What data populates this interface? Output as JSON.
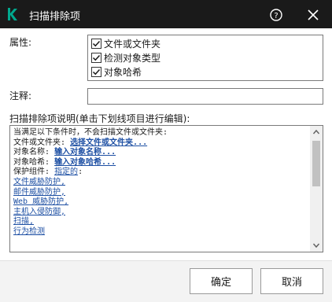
{
  "window": {
    "title": "扫描排除项",
    "logo_glyph": "K",
    "brand_color": "#00a88e",
    "titlebar_color": "#1a1a1a"
  },
  "form": {
    "attributes_label": "属性:",
    "attributes": [
      {
        "label": "文件或文件夹",
        "checked": true
      },
      {
        "label": "检测对象类型",
        "checked": true
      },
      {
        "label": "对象哈希",
        "checked": true
      }
    ],
    "comment_label": "注释:",
    "comment_value": "",
    "description_label": "扫描排除项说明(单击下划线项目进行编辑):"
  },
  "description": {
    "line1": "当满足以下条件时，不会扫描文件或文件夹:",
    "file_label": "文件或文件夹:",
    "file_link": "选择文件或文件夹...",
    "object_name_label": "对象名称:",
    "object_name_link": "输入对象名称...",
    "object_hash_label": "对象哈希:",
    "object_hash_link": "输入对象哈希...",
    "protection_label": "保护组件:",
    "protection_link": "指定的",
    "protection_suffix": ":",
    "components": [
      "文件威胁防护,",
      "邮件威胁防护,",
      "Web 威胁防护,",
      "主机入侵防御,",
      "扫描,",
      "行为检测"
    ],
    "link_color": "#1d4fa3"
  },
  "buttons": {
    "ok": "确定",
    "cancel": "取消"
  }
}
